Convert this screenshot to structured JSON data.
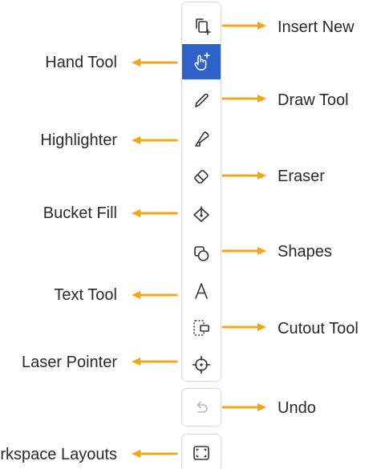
{
  "colors": {
    "arrow": "#f2a618",
    "active": "#2d62c8",
    "icon": "#333333",
    "icon_disabled": "#b9b9b9",
    "panel_border": "#dcdcdc"
  },
  "tools": [
    {
      "id": "insert-new",
      "icon": "insert-new-icon",
      "label": "Insert New",
      "side": "right"
    },
    {
      "id": "hand-tool",
      "icon": "hand-add-icon",
      "label": "Hand Tool",
      "side": "left",
      "active": true
    },
    {
      "id": "draw-tool",
      "icon": "pencil-icon",
      "label": "Draw Tool",
      "side": "right"
    },
    {
      "id": "highlighter",
      "icon": "highlighter-icon",
      "label": "Highlighter",
      "side": "left"
    },
    {
      "id": "eraser",
      "icon": "eraser-icon",
      "label": "Eraser",
      "side": "right"
    },
    {
      "id": "bucket-fill",
      "icon": "bucket-fill-icon",
      "label": "Bucket Fill",
      "side": "left"
    },
    {
      "id": "shapes",
      "icon": "shapes-icon",
      "label": "Shapes",
      "side": "right"
    },
    {
      "id": "text-tool",
      "icon": "text-a-icon",
      "label": "Text Tool",
      "side": "left"
    },
    {
      "id": "cutout-tool",
      "icon": "cutout-icon",
      "label": "Cutout Tool",
      "side": "right"
    },
    {
      "id": "laser-pointer",
      "icon": "crosshair-icon",
      "label": "Laser Pointer",
      "side": "left"
    },
    {
      "id": "undo",
      "icon": "undo-icon",
      "label": "Undo",
      "side": "right",
      "disabled": true
    },
    {
      "id": "workspace-layouts",
      "icon": "layout-frame-icon",
      "label": "Workspace Layouts",
      "side": "left"
    }
  ]
}
